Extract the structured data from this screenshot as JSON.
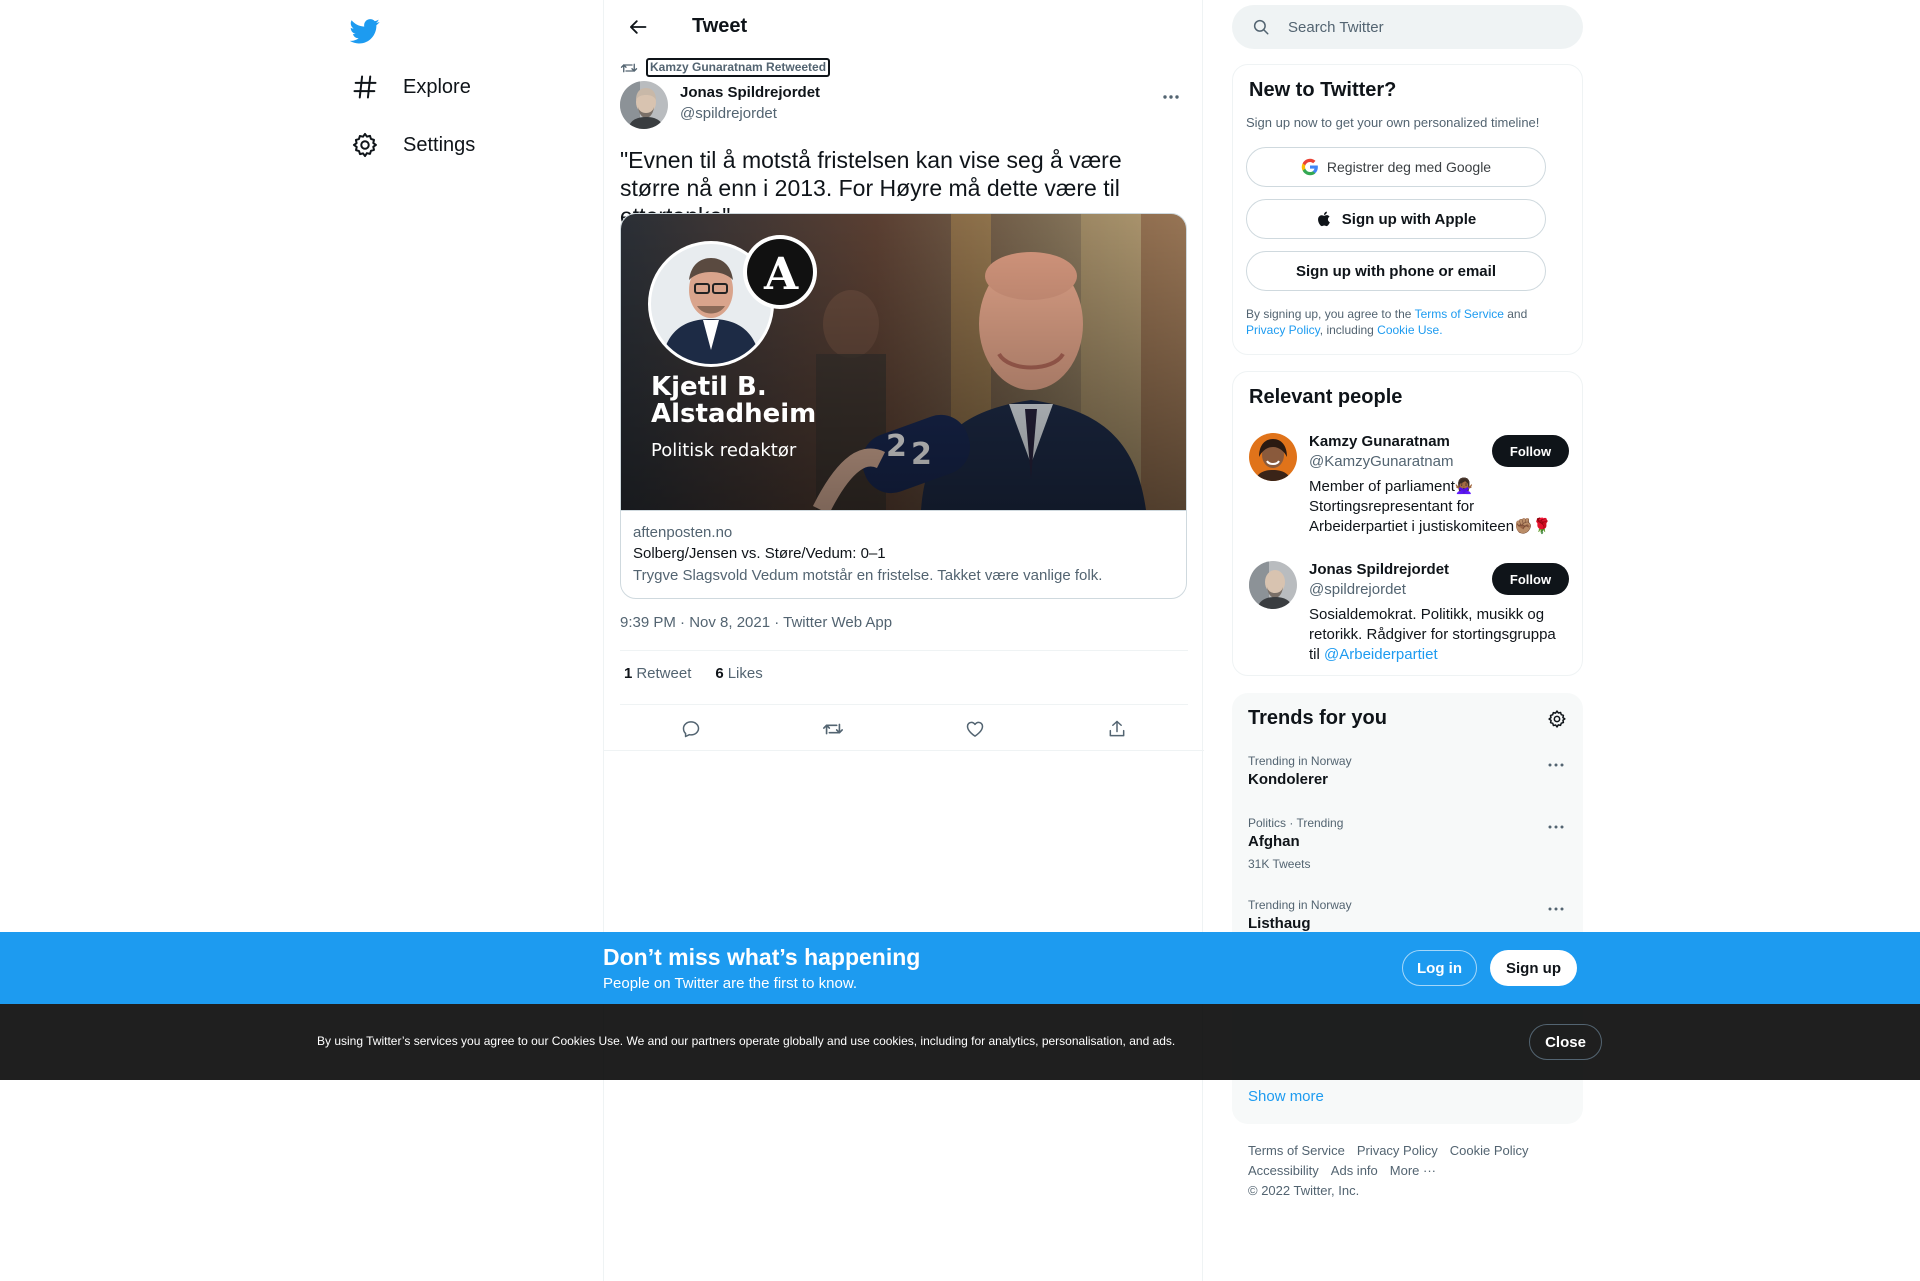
{
  "nav": {
    "logo_icon": "twitter-bird-icon",
    "items": [
      {
        "label": "Explore",
        "icon": "hashtag-icon"
      },
      {
        "label": "Settings",
        "icon": "gear-icon"
      }
    ]
  },
  "header": {
    "title": "Tweet",
    "back_icon": "arrow-left-icon"
  },
  "tweet": {
    "retweet_context": "Kamzy Gunaratnam Retweeted",
    "author_name": "Jonas Spildrejordet",
    "author_handle": "@spildrejordet",
    "text": "\"Evnen til å motstå fristelsen kan vise seg å være større nå enn i 2013. For Høyre må dette være til ettertanke\"",
    "card": {
      "image_overlay_name": "Kjetil B. Alstadheim",
      "image_overlay_role": "Politisk redaktør",
      "mic_label": "2",
      "domain": "aftenposten.no",
      "title": "Solberg/Jensen vs. Støre/Vedum: 0–1",
      "description": "Trygve Slagsvold Vedum motstår en fristelse. Takket være vanlige folk."
    },
    "timestamp": "9:39 PM · Nov 8, 2021 · Twitter Web App",
    "retweets_count": "1",
    "retweets_label": "Retweet",
    "likes_count": "6",
    "likes_label": "Likes"
  },
  "search": {
    "placeholder": "Search Twitter"
  },
  "signup_panel": {
    "title": "New to Twitter?",
    "subtitle": "Sign up now to get your own personalized timeline!",
    "google_label": "Registrer deg med Google",
    "apple_label": "Sign up with Apple",
    "phone_label": "Sign up with phone or email",
    "legal_prefix": "By signing up, you agree to the ",
    "terms": "Terms of Service",
    "and": " and ",
    "privacy": "Privacy Policy",
    "including": ", including ",
    "cookie": "Cookie Use."
  },
  "people_panel": {
    "title": "Relevant people",
    "people": [
      {
        "name": "Kamzy Gunaratnam",
        "handle": "@KamzyGunaratnam",
        "bio": "Member of parliament🙅🏾‍♀️ Stortingsrepresentant for Arbeiderpartiet i justiskomiteen✊🏽🌹",
        "follow_label": "Follow"
      },
      {
        "name": "Jonas Spildrejordet",
        "handle": "@spildrejordet",
        "bio_text": "Sosialdemokrat. Politikk, musikk og retorikk. Rådgiver for stortingsgruppa til ",
        "bio_link": "@Arbeiderpartiet",
        "follow_label": "Follow"
      }
    ]
  },
  "trends_panel": {
    "title": "Trends for you",
    "trends": [
      {
        "context": "Trending in Norway",
        "name": "Kondolerer",
        "count": ""
      },
      {
        "context": "Politics · Trending",
        "name": "Afghan",
        "count": "31K Tweets"
      },
      {
        "context": "Trending in Norway",
        "name": "Listhaug",
        "count": ""
      }
    ],
    "show_more": "Show more"
  },
  "footer": {
    "links": [
      "Terms of Service",
      "Privacy Policy",
      "Cookie Policy",
      "Accessibility",
      "Ads info",
      "More ···"
    ],
    "copyright": "© 2022 Twitter, Inc."
  },
  "bottom_bar": {
    "title": "Don’t miss what’s happening",
    "subtitle": "People on Twitter are the first to know.",
    "login_label": "Log in",
    "signup_label": "Sign up"
  },
  "cookie_bar": {
    "text": "By using Twitter’s services you agree to our Cookies Use. We and our partners operate globally and use cookies, including for analytics, personalisation, and ads.",
    "close_label": "Close"
  },
  "colors": {
    "brand": "#1d9bf0",
    "text_primary": "#0f1419",
    "text_secondary": "#536471",
    "border": "#eff3f4"
  }
}
